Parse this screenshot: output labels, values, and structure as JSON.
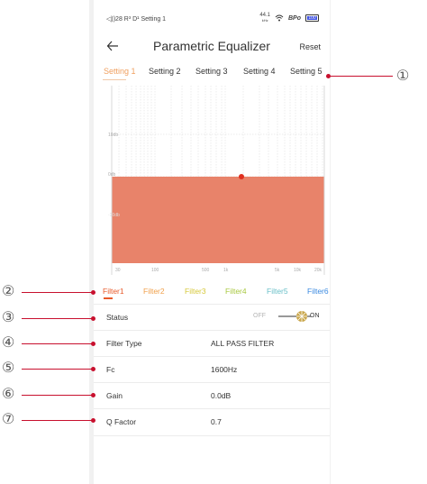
{
  "status_bar": {
    "left": "◁))28 R³ D¹ Setting 1",
    "sample_rate": "44.1",
    "sample_rate_unit": "kHz",
    "codec": "BPo",
    "battery": "100"
  },
  "header": {
    "title": "Parametric Equalizer",
    "reset_label": "Reset",
    "back_icon": "arrow-left-icon"
  },
  "settings_tabs": {
    "active_index": 0,
    "items": [
      {
        "label": "Setting 1"
      },
      {
        "label": "Setting 2"
      },
      {
        "label": "Setting 3"
      },
      {
        "label": "Setting 4"
      },
      {
        "label": "Setting 5"
      }
    ]
  },
  "eq_chart": {
    "y_labels": [
      "10db",
      "0db",
      "-10db"
    ],
    "x_labels": [
      "30",
      "100",
      "500",
      "1k",
      "5k",
      "10k",
      "20k"
    ],
    "fill_color": "#e8836a",
    "point_color": "#e03020",
    "point_frequency": "1600Hz",
    "point_gain": "0.0dB"
  },
  "filter_tabs": {
    "active_index": 0,
    "items": [
      {
        "label": "Filter1",
        "color": "#e85a2a"
      },
      {
        "label": "Filter2",
        "color": "#f0a04a"
      },
      {
        "label": "Filter3",
        "color": "#d6c83a"
      },
      {
        "label": "Filter4",
        "color": "#a8c840"
      },
      {
        "label": "Filter5",
        "color": "#6ac0c8"
      },
      {
        "label": "Filter6",
        "color": "#3a8ae0"
      }
    ]
  },
  "params": {
    "status": {
      "label": "Status",
      "off_label": "OFF",
      "on_label": "ON",
      "value": "ON"
    },
    "filter_type": {
      "label": "Filter Type",
      "value": "ALL PASS FILTER"
    },
    "fc": {
      "label": "Fc",
      "value": "1600Hz"
    },
    "gain": {
      "label": "Gain",
      "value": "0.0dB"
    },
    "q_factor": {
      "label": "Q Factor",
      "value": "0.7"
    }
  },
  "callouts": {
    "items": [
      "①",
      "②",
      "③",
      "④",
      "⑤",
      "⑥",
      "⑦"
    ],
    "line_color": "#c8102e"
  }
}
